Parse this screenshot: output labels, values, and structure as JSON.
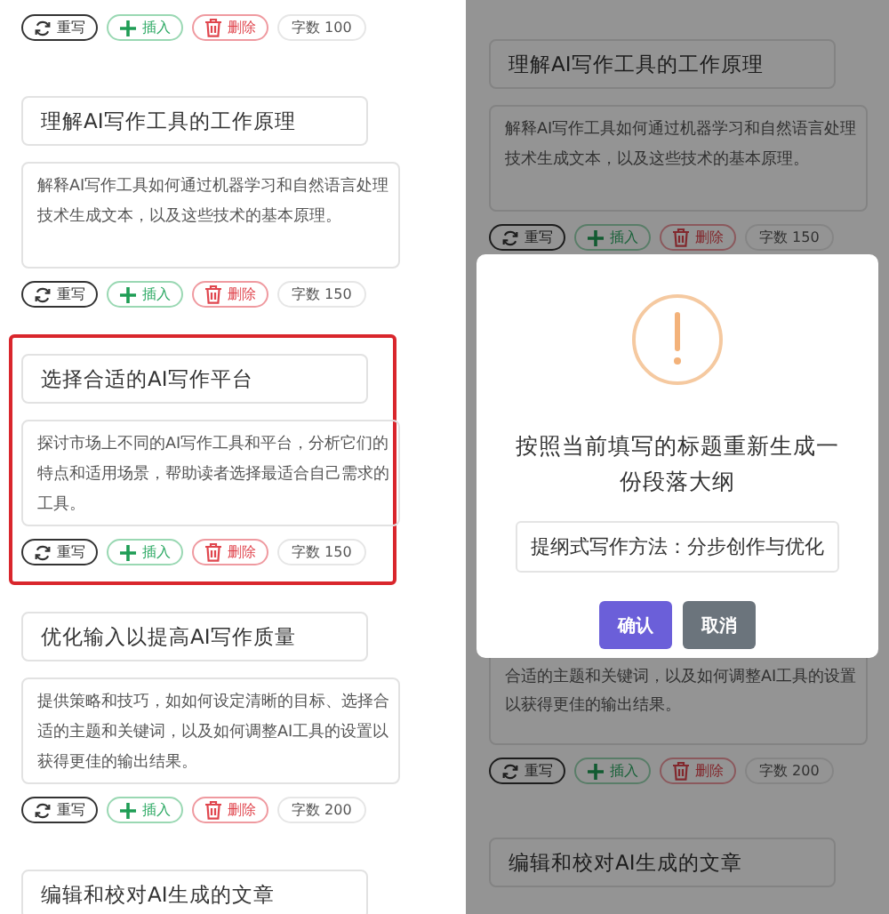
{
  "left_panel": {
    "sections": [
      {
        "selected": false,
        "actions": [
          {
            "kind": "rewrite",
            "label": "重写"
          },
          {
            "kind": "insert",
            "label": "插入"
          },
          {
            "kind": "delete",
            "label": "删除"
          }
        ],
        "word_count": "字数 100"
      },
      {
        "selected": false,
        "title": "理解AI写作工具的工作原理",
        "description": "解释AI写作工具如何通过机器学习和自然语言处理技术生成文本，以及这些技术的基本原理。",
        "actions": [
          {
            "kind": "rewrite",
            "label": "重写"
          },
          {
            "kind": "insert",
            "label": "插入"
          },
          {
            "kind": "delete",
            "label": "删除"
          }
        ],
        "word_count": "字数 150"
      },
      {
        "selected": true,
        "title": "选择合适的AI写作平台",
        "description": "探讨市场上不同的AI写作工具和平台，分析它们的特点和适用场景，帮助读者选择最适合自己需求的工具。",
        "actions": [
          {
            "kind": "rewrite",
            "label": "重写"
          },
          {
            "kind": "insert",
            "label": "插入"
          },
          {
            "kind": "delete",
            "label": "删除"
          }
        ],
        "word_count": "字数 150"
      },
      {
        "selected": false,
        "title": "优化输入以提高AI写作质量",
        "description": "提供策略和技巧，如如何设定清晰的目标、选择合适的主题和关键词，以及如何调整AI工具的设置以获得更佳的输出结果。",
        "actions": [
          {
            "kind": "rewrite",
            "label": "重写"
          },
          {
            "kind": "insert",
            "label": "插入"
          },
          {
            "kind": "delete",
            "label": "删除"
          }
        ],
        "word_count": "字数 200"
      },
      {
        "selected": false,
        "title": "编辑和校对AI生成的文章"
      }
    ]
  },
  "right_panel": {
    "sections": [
      {
        "title": "理解AI写作工具的工作原理",
        "description": "解释AI写作工具如何通过机器学习和自然语言处理技术生成文本，以及这些技术的基本原理。",
        "actions": [
          {
            "kind": "rewrite",
            "label": "重写"
          },
          {
            "kind": "insert",
            "label": "插入"
          },
          {
            "kind": "delete",
            "label": "删除"
          }
        ],
        "word_count": "字数 150"
      },
      {
        "description": "合适的主题和关键词，以及如何调整AI工具的设置以获得更佳的输出结果。",
        "actions": [
          {
            "kind": "rewrite",
            "label": "重写"
          },
          {
            "kind": "insert",
            "label": "插入"
          },
          {
            "kind": "delete",
            "label": "删除"
          }
        ],
        "word_count": "字数 200"
      },
      {
        "title": "编辑和校对AI生成的文章"
      }
    ],
    "dialog": {
      "message": "按照当前填写的标题重新生成一份段落大纲",
      "value": "提纲式写作方法：分步创作与优化",
      "buttons": [
        {
          "kind": "primary",
          "label": "确认"
        },
        {
          "kind": "secondary",
          "label": "取消"
        }
      ]
    }
  }
}
